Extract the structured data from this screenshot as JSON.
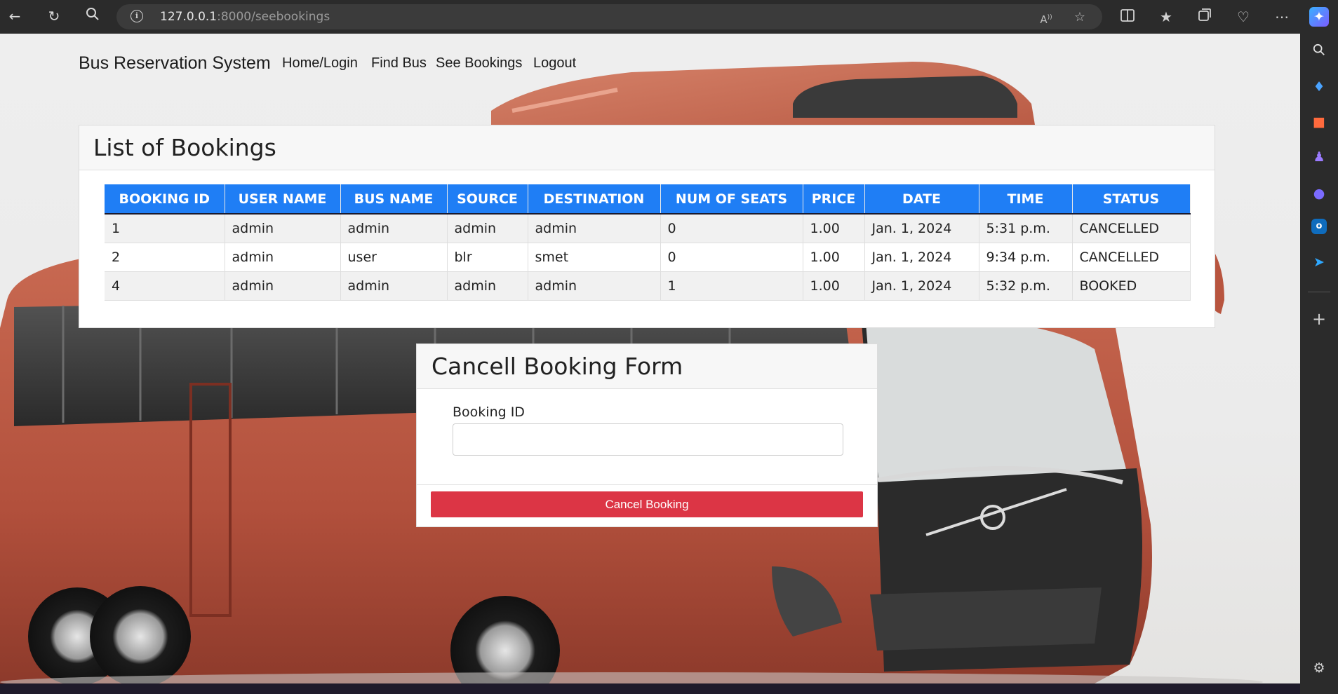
{
  "browser": {
    "url_host": "127.0.0.1",
    "url_rest": ":8000/seebookings",
    "icons": {
      "back": "back-arrow-icon",
      "refresh": "refresh-icon",
      "search": "search-icon",
      "info": "info-icon",
      "read_aloud": "read-aloud-icon",
      "favorite": "star-icon",
      "split": "split-screen-icon",
      "favorites": "favorites-icon",
      "collections": "collections-icon",
      "health": "browser-essentials-icon",
      "more": "more-icon",
      "copilot": "copilot-icon"
    }
  },
  "sidebar": {
    "icons": [
      "search-icon",
      "shopping-tag-icon",
      "briefcase-icon",
      "games-icon",
      "m365-icon",
      "outlook-icon",
      "send-icon",
      "add-icon",
      "settings-icon"
    ]
  },
  "navbar": {
    "brand": "Bus Reservation System",
    "links": [
      "Home/Login",
      "Find Bus",
      "See Bookings",
      "Logout"
    ]
  },
  "bookings": {
    "title": "List of Bookings",
    "columns": [
      "BOOKING ID",
      "USER NAME",
      "BUS NAME",
      "SOURCE",
      "DESTINATION",
      "NUM OF SEATS",
      "PRICE",
      "DATE",
      "TIME",
      "STATUS"
    ],
    "rows": [
      [
        "1",
        "admin",
        "admin",
        "admin",
        "admin",
        "0",
        "1.00",
        "Jan. 1, 2024",
        "5:31 p.m.",
        "CANCELLED"
      ],
      [
        "2",
        "admin",
        "user",
        "blr",
        "smet",
        "0",
        "1.00",
        "Jan. 1, 2024",
        "9:34 p.m.",
        "CANCELLED"
      ],
      [
        "4",
        "admin",
        "admin",
        "admin",
        "admin",
        "1",
        "1.00",
        "Jan. 1, 2024",
        "5:32 p.m.",
        "BOOKED"
      ]
    ]
  },
  "cancel_form": {
    "title": "Cancell Booking Form",
    "field_label": "Booking ID",
    "field_value": "",
    "button_label": "Cancel Booking"
  },
  "colors": {
    "table_header": "#1f7ef5",
    "danger": "#dc3545"
  }
}
